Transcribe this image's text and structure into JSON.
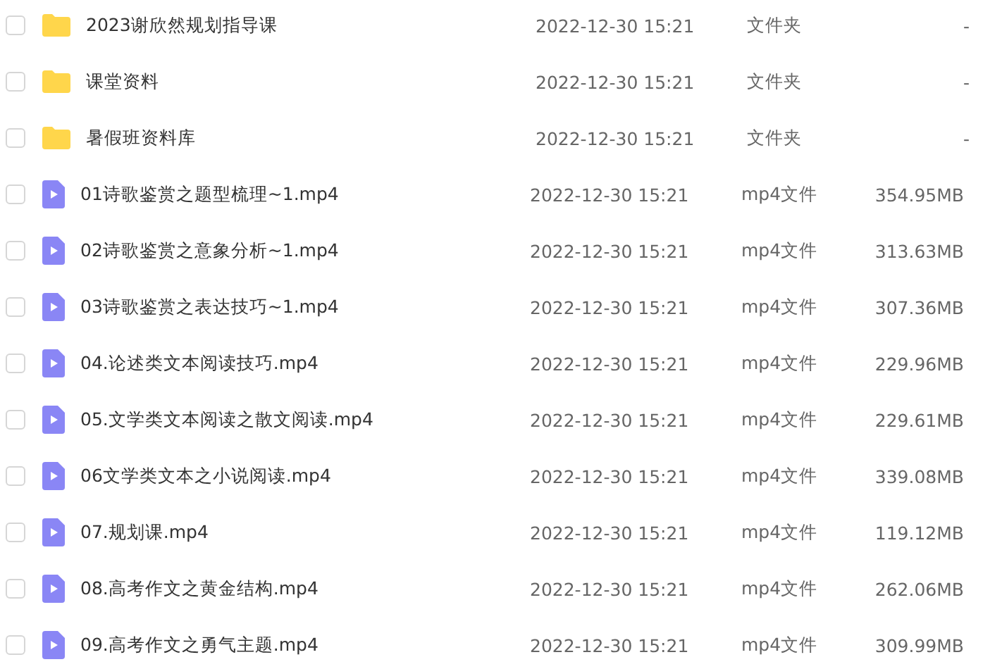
{
  "files": [
    {
      "kind": "folder",
      "name": "2023谢欣然规划指导课",
      "modified": "2022-12-30 15:21",
      "type": "文件夹",
      "size": "-",
      "checked": false
    },
    {
      "kind": "folder",
      "name": "课堂资料",
      "modified": "2022-12-30 15:21",
      "type": "文件夹",
      "size": "-",
      "checked": false
    },
    {
      "kind": "folder",
      "name": "暑假班资料库",
      "modified": "2022-12-30 15:21",
      "type": "文件夹",
      "size": "-",
      "checked": false
    },
    {
      "kind": "video",
      "name": "01诗歌鉴赏之题型梳理~1.mp4",
      "modified": "2022-12-30 15:21",
      "type": "mp4文件",
      "size": "354.95MB",
      "checked": false
    },
    {
      "kind": "video",
      "name": "02诗歌鉴赏之意象分析~1.mp4",
      "modified": "2022-12-30 15:21",
      "type": "mp4文件",
      "size": "313.63MB",
      "checked": false
    },
    {
      "kind": "video",
      "name": "03诗歌鉴赏之表达技巧~1.mp4",
      "modified": "2022-12-30 15:21",
      "type": "mp4文件",
      "size": "307.36MB",
      "checked": false
    },
    {
      "kind": "video",
      "name": "04.论述类文本阅读技巧.mp4",
      "modified": "2022-12-30 15:21",
      "type": "mp4文件",
      "size": "229.96MB",
      "checked": false
    },
    {
      "kind": "video",
      "name": "05.文学类文本阅读之散文阅读.mp4",
      "modified": "2022-12-30 15:21",
      "type": "mp4文件",
      "size": "229.61MB",
      "checked": false
    },
    {
      "kind": "video",
      "name": "06文学类文本之小说阅读.mp4",
      "modified": "2022-12-30 15:21",
      "type": "mp4文件",
      "size": "339.08MB",
      "checked": false
    },
    {
      "kind": "video",
      "name": "07.规划课.mp4",
      "modified": "2022-12-30 15:21",
      "type": "mp4文件",
      "size": "119.12MB",
      "checked": false
    },
    {
      "kind": "video",
      "name": "08.高考作文之黄金结构.mp4",
      "modified": "2022-12-30 15:21",
      "type": "mp4文件",
      "size": "262.06MB",
      "checked": false
    },
    {
      "kind": "video",
      "name": "09.高考作文之勇气主题.mp4",
      "modified": "2022-12-30 15:21",
      "type": "mp4文件",
      "size": "309.99MB",
      "checked": false
    }
  ]
}
